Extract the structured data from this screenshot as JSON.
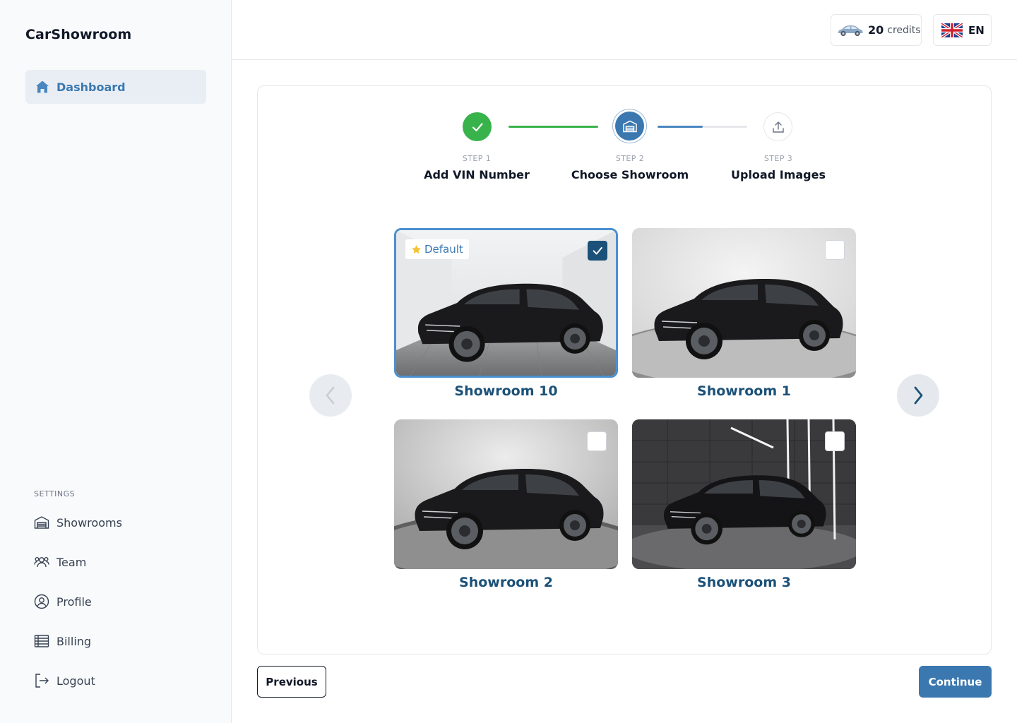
{
  "app": {
    "brand": "CarShowroom"
  },
  "sidebar": {
    "active_item": {
      "label": "Dashboard",
      "icon": "home-icon"
    },
    "settings_heading": "SETTINGS",
    "items": [
      {
        "label": "Showrooms",
        "icon": "garage-icon"
      },
      {
        "label": "Team",
        "icon": "team-icon"
      },
      {
        "label": "Profile",
        "icon": "user-circle-icon"
      },
      {
        "label": "Billing",
        "icon": "billing-icon"
      },
      {
        "label": "Logout",
        "icon": "logout-icon"
      }
    ]
  },
  "header": {
    "credits_count": "20",
    "credits_label": "credits",
    "language_code": "EN"
  },
  "stepper": {
    "steps": [
      {
        "number": "STEP 1",
        "title": "Add VIN Number",
        "status": "complete"
      },
      {
        "number": "STEP 2",
        "title": "Choose Showroom",
        "status": "current"
      },
      {
        "number": "STEP 3",
        "title": "Upload Images",
        "status": "upcoming"
      }
    ],
    "progress_current_connector": 0.5
  },
  "showrooms": [
    {
      "name": "Showroom 10",
      "selected": true,
      "badge": "Default"
    },
    {
      "name": "Showroom 1",
      "selected": false
    },
    {
      "name": "Showroom 2",
      "selected": false
    },
    {
      "name": "Showroom 3",
      "selected": false
    }
  ],
  "buttons": {
    "previous": "Previous",
    "continue": "Continue"
  },
  "colors": {
    "accent": "#3b78b0",
    "success": "#38b24a",
    "heading_dark_blue": "#1b5178"
  }
}
